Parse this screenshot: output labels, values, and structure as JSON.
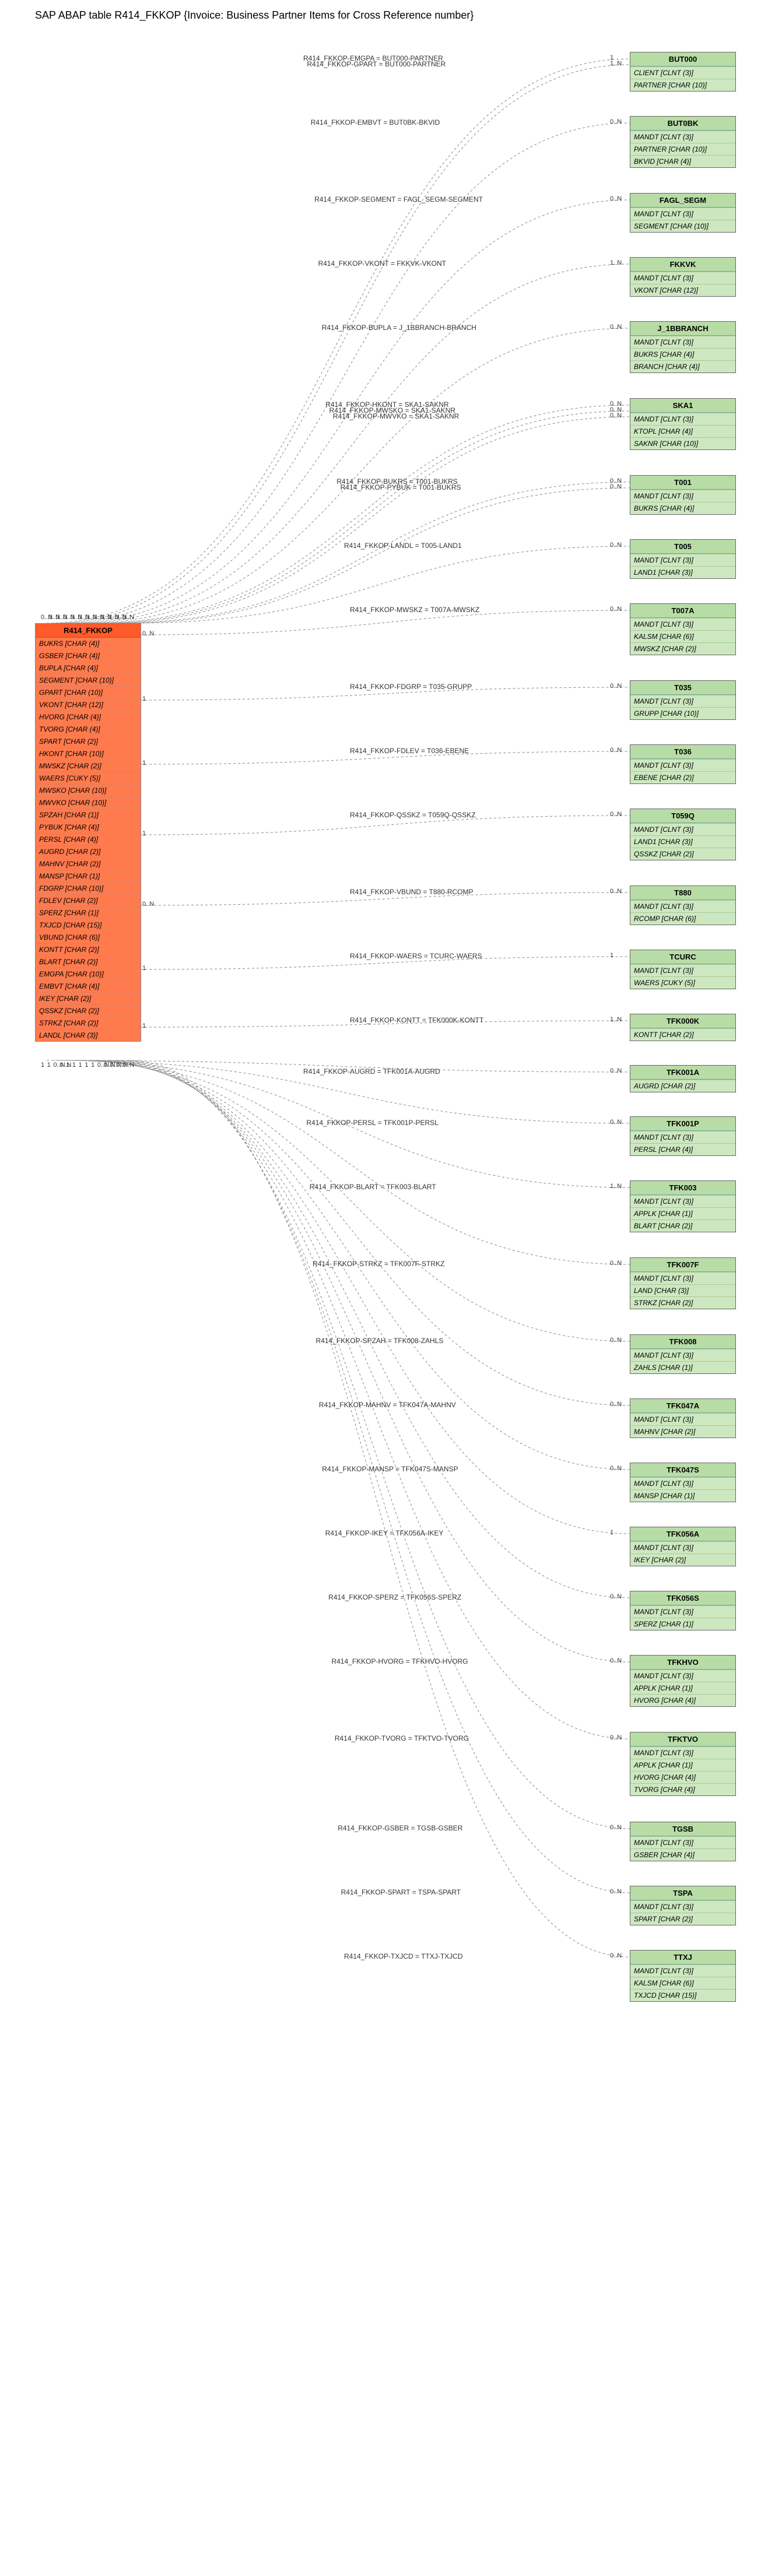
{
  "title": "SAP ABAP table R414_FKKOP {Invoice: Business Partner Items for Cross Reference number}",
  "main": {
    "name": "R414_FKKOP",
    "fields": [
      "BUKRS [CHAR (4)]",
      "GSBER [CHAR (4)]",
      "BUPLA [CHAR (4)]",
      "SEGMENT [CHAR (10)]",
      "GPART [CHAR (10)]",
      "VKONT [CHAR (12)]",
      "HVORG [CHAR (4)]",
      "TVORG [CHAR (4)]",
      "SPART [CHAR (2)]",
      "HKONT [CHAR (10)]",
      "MWSKZ [CHAR (2)]",
      "WAERS [CUKY (5)]",
      "MWSKO [CHAR (10)]",
      "MWVKO [CHAR (10)]",
      "SPZAH [CHAR (1)]",
      "PYBUK [CHAR (4)]",
      "PERSL [CHAR (4)]",
      "AUGRD [CHAR (2)]",
      "MAHNV [CHAR (2)]",
      "MANSP [CHAR (1)]",
      "FDGRP [CHAR (10)]",
      "FDLEV [CHAR (2)]",
      "SPERZ [CHAR (1)]",
      "TXJCD [CHAR (15)]",
      "VBUND [CHAR (6)]",
      "KONTT [CHAR (2)]",
      "BLART [CHAR (2)]",
      "EMGPA [CHAR (10)]",
      "EMBVT [CHAR (4)]",
      "IKEY [CHAR (2)]",
      "QSSKZ [CHAR (2)]",
      "STRKZ [CHAR (2)]",
      "LANDL [CHAR (3)]"
    ]
  },
  "targets": [
    {
      "name": "BUT000",
      "fields": [
        "CLIENT [CLNT (3)]",
        "PARTNER [CHAR (10)]"
      ],
      "edge": "R414_FKKOP-EMGPA = BUT000-PARTNER",
      "cardL": "0..N",
      "cardR": "1"
    },
    {
      "name": "",
      "fields": [],
      "edge": "R414_FKKOP-GPART = BUT000-PARTNER",
      "cardL": "0..N",
      "cardR": "1..N",
      "skip": true
    },
    {
      "name": "BUT0BK",
      "fields": [
        "MANDT [CLNT (3)]",
        "PARTNER [CHAR (10)]",
        "BKVID [CHAR (4)]"
      ],
      "edge": "R414_FKKOP-EMBVT = BUT0BK-BKVID",
      "cardL": "0..N",
      "cardR": "0..N"
    },
    {
      "name": "FAGL_SEGM",
      "fields": [
        "MANDT [CLNT (3)]",
        "SEGMENT [CHAR (10)]"
      ],
      "edge": "R414_FKKOP-SEGMENT = FAGL_SEGM-SEGMENT",
      "cardL": "0..N",
      "cardR": "0..N"
    },
    {
      "name": "FKKVK",
      "fields": [
        "MANDT [CLNT (3)]",
        "VKONT [CHAR (12)]"
      ],
      "edge": "R414_FKKOP-VKONT = FKKVK-VKONT",
      "cardL": "0..N",
      "cardR": "1..N"
    },
    {
      "name": "J_1BBRANCH",
      "fields": [
        "MANDT [CLNT (3)]",
        "BUKRS [CHAR (4)]",
        "BRANCH [CHAR (4)]"
      ],
      "edge": "R414_FKKOP-BUPLA = J_1BBRANCH-BRANCH",
      "cardL": "0..N",
      "cardR": "0..N"
    },
    {
      "name": "SKA1",
      "fields": [
        "MANDT [CLNT (3)]",
        "KTOPL [CHAR (4)]",
        "SAKNR [CHAR (10)]"
      ],
      "edge": "R414_FKKOP-HKONT = SKA1-SAKNR",
      "cardL": "0..N",
      "cardR": "0..N"
    },
    {
      "name": "",
      "fields": [],
      "edge": "R414_FKKOP-MWSKO = SKA1-SAKNR",
      "cardL": "0..N",
      "cardR": "0..N",
      "skip": true
    },
    {
      "name": "",
      "fields": [],
      "edge": "R414_FKKOP-MWVKO = SKA1-SAKNR",
      "cardL": "0..N",
      "cardR": "0..N",
      "skip": true
    },
    {
      "name": "T001",
      "fields": [
        "MANDT [CLNT (3)]",
        "BUKRS [CHAR (4)]"
      ],
      "edge": "R414_FKKOP-BUKRS = T001-BUKRS",
      "cardL": "0..N",
      "cardR": "0..N"
    },
    {
      "name": "",
      "fields": [],
      "edge": "R414_FKKOP-PYBUK = T001-BUKRS",
      "cardL": "0..N",
      "cardR": "0..N",
      "skip": true
    },
    {
      "name": "T005",
      "fields": [
        "MANDT [CLNT (3)]",
        "LAND1 [CHAR (3)]"
      ],
      "edge": "R414_FKKOP-LANDL = T005-LAND1",
      "cardL": "0..N",
      "cardR": "0..N"
    },
    {
      "name": "T007A",
      "fields": [
        "MANDT [CLNT (3)]",
        "KALSM [CHAR (6)]",
        "MWSKZ [CHAR (2)]"
      ],
      "edge": "R414_FKKOP-MWSKZ = T007A-MWSKZ",
      "cardL": "0..N",
      "cardR": "0..N"
    },
    {
      "name": "T035",
      "fields": [
        "MANDT [CLNT (3)]",
        "GRUPP [CHAR (10)]"
      ],
      "edge": "R414_FKKOP-FDGRP = T035-GRUPP",
      "cardL": "1",
      "cardR": "0..N"
    },
    {
      "name": "T036",
      "fields": [
        "MANDT [CLNT (3)]",
        "EBENE [CHAR (2)]"
      ],
      "edge": "R414_FKKOP-FDLEV = T036-EBENE",
      "cardL": "1",
      "cardR": "0..N"
    },
    {
      "name": "T059Q",
      "fields": [
        "MANDT [CLNT (3)]",
        "LAND1 [CHAR (3)]",
        "QSSKZ [CHAR (2)]"
      ],
      "edge": "R414_FKKOP-QSSKZ = T059Q-QSSKZ",
      "cardL": "1",
      "cardR": "0..N"
    },
    {
      "name": "T880",
      "fields": [
        "MANDT [CLNT (3)]",
        "RCOMP [CHAR (6)]"
      ],
      "edge": "R414_FKKOP-VBUND = T880-RCOMP",
      "cardL": "0..N",
      "cardR": "0..N"
    },
    {
      "name": "TCURC",
      "fields": [
        "MANDT [CLNT (3)]",
        "WAERS [CUKY (5)]"
      ],
      "edge": "R414_FKKOP-WAERS = TCURC-WAERS",
      "cardL": "1",
      "cardR": "1"
    },
    {
      "name": "TFK000K",
      "fields": [
        "KONTT [CHAR (2)]"
      ],
      "edge": "R414_FKKOP-KONTT = TFK000K-KONTT",
      "cardL": "1",
      "cardR": "1..N"
    },
    {
      "name": "TFK001A",
      "fields": [
        "AUGRD [CHAR (2)]"
      ],
      "edge": "R414_FKKOP-AUGRD = TFK001A-AUGRD",
      "cardL": "1",
      "cardR": "0..N"
    },
    {
      "name": "TFK001P",
      "fields": [
        "MANDT [CLNT (3)]",
        "PERSL [CHAR (4)]"
      ],
      "edge": "R414_FKKOP-PERSL = TFK001P-PERSL",
      "cardL": "1",
      "cardR": "0..N"
    },
    {
      "name": "TFK003",
      "fields": [
        "MANDT [CLNT (3)]",
        "APPLK [CHAR (1)]",
        "BLART [CHAR (2)]"
      ],
      "edge": "R414_FKKOP-BLART = TFK003-BLART",
      "cardL": "0..N",
      "cardR": "1..N"
    },
    {
      "name": "TFK007F",
      "fields": [
        "MANDT [CLNT (3)]",
        "LAND [CHAR (3)]",
        "STRKZ [CHAR (2)]"
      ],
      "edge": "R414_FKKOP-STRKZ = TFK007F-STRKZ",
      "cardL": "0..N",
      "cardR": "0..N"
    },
    {
      "name": "TFK008",
      "fields": [
        "MANDT [CLNT (3)]",
        "ZAHLS [CHAR (1)]"
      ],
      "edge": "R414_FKKOP-SPZAH = TFK008-ZAHLS",
      "cardL": "1",
      "cardR": "0..N"
    },
    {
      "name": "TFK047A",
      "fields": [
        "MANDT [CLNT (3)]",
        "MAHNV [CHAR (2)]"
      ],
      "edge": "R414_FKKOP-MAHNV = TFK047A-MAHNV",
      "cardL": "1",
      "cardR": "0..N"
    },
    {
      "name": "TFK047S",
      "fields": [
        "MANDT [CLNT (3)]",
        "MANSP [CHAR (1)]"
      ],
      "edge": "R414_FKKOP-MANSP = TFK047S-MANSP",
      "cardL": "1",
      "cardR": "0..N"
    },
    {
      "name": "TFK056A",
      "fields": [
        "MANDT [CLNT (3)]",
        "IKEY [CHAR (2)]"
      ],
      "edge": "R414_FKKOP-IKEY = TFK056A-IKEY",
      "cardL": "1",
      "cardR": "1"
    },
    {
      "name": "TFK056S",
      "fields": [
        "MANDT [CLNT (3)]",
        "SPERZ [CHAR (1)]"
      ],
      "edge": "R414_FKKOP-SPERZ = TFK056S-SPERZ",
      "cardL": "1",
      "cardR": "0..N"
    },
    {
      "name": "TFKHVO",
      "fields": [
        "MANDT [CLNT (3)]",
        "APPLK [CHAR (1)]",
        "HVORG [CHAR (4)]"
      ],
      "edge": "R414_FKKOP-HVORG = TFKHVO-HVORG",
      "cardL": "0..N",
      "cardR": "0..N"
    },
    {
      "name": "TFKTVO",
      "fields": [
        "MANDT [CLNT (3)]",
        "APPLK [CHAR (1)]",
        "HVORG [CHAR (4)]",
        "TVORG [CHAR (4)]"
      ],
      "edge": "R414_FKKOP-TVORG = TFKTVO-TVORG",
      "cardL": "0..N",
      "cardR": "0..N"
    },
    {
      "name": "TGSB",
      "fields": [
        "MANDT [CLNT (3)]",
        "GSBER [CHAR (4)]"
      ],
      "edge": "R414_FKKOP-GSBER = TGSB-GSBER",
      "cardL": "0..N",
      "cardR": "0..N"
    },
    {
      "name": "TSPA",
      "fields": [
        "MANDT [CLNT (3)]",
        "SPART [CHAR (2)]"
      ],
      "edge": "R414_FKKOP-SPART = TSPA-SPART",
      "cardL": "0..N",
      "cardR": "0..N"
    },
    {
      "name": "TTXJ",
      "fields": [
        "MANDT [CLNT (3)]",
        "KALSM [CHAR (6)]",
        "TXJCD [CHAR (15)]"
      ],
      "edge": "R414_FKKOP-TXJCD = TTXJ-TXJCD",
      "cardL": "0..N",
      "cardR": "0..N"
    }
  ]
}
